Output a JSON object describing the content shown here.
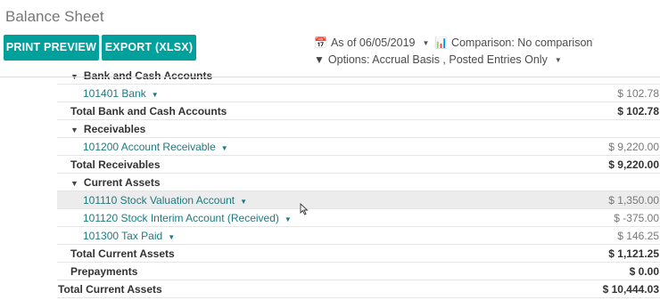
{
  "header": {
    "title": "Balance Sheet",
    "print_label": "PRINT PREVIEW",
    "export_label": "EXPORT (XLSX)",
    "date_filter": "As of 06/05/2019",
    "comparison_filter": "Comparison: No comparison",
    "options_filter": "Options: Accrual Basis , Posted Entries Only"
  },
  "icons": {
    "calendar": "calendar-icon",
    "chart": "bar-chart-icon",
    "filter": "filter-icon"
  },
  "report": {
    "cut_row_label": "Bank and Cash Accounts",
    "rows": [
      {
        "label": "101401 Bank",
        "value": "$ 102.78"
      },
      {
        "label": "Total Bank and Cash Accounts",
        "value": "$ 102.78"
      },
      {
        "label": "Receivables"
      },
      {
        "label": "101200 Account Receivable",
        "value": "$ 9,220.00"
      },
      {
        "label": "Total Receivables",
        "value": "$ 9,220.00"
      },
      {
        "label": "Current Assets"
      },
      {
        "label": "101110 Stock Valuation Account",
        "value": "$ 1,350.00"
      },
      {
        "label": "101120 Stock Interim Account (Received)",
        "value": "$ -375.00"
      },
      {
        "label": "101300 Tax Paid",
        "value": "$ 146.25"
      },
      {
        "label": "Total Current Assets",
        "value": "$ 1,121.25"
      },
      {
        "label": "Prepayments",
        "value": "$ 0.00"
      },
      {
        "label": "Total Current Assets",
        "value": "$ 10,444.03"
      }
    ]
  },
  "colors": {
    "primary": "#00a09d",
    "account_link": "#1d7a80",
    "highlight_row": "#ececec"
  }
}
